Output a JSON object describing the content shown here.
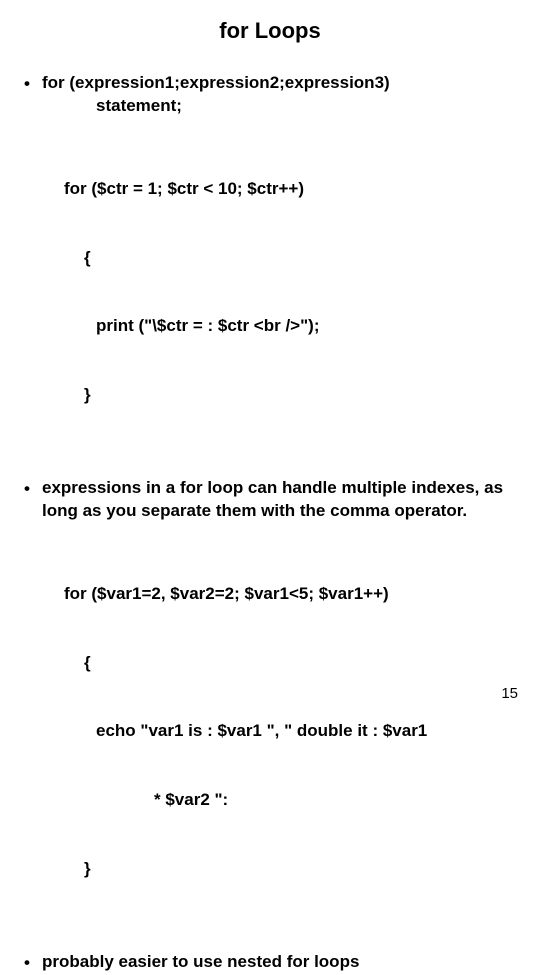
{
  "title": "for Loops",
  "bullets": {
    "b1_line1": "for (expression1;expression2;expression3)",
    "b1_line2": "statement;",
    "b2": "expressions in a for loop can handle multiple indexes, as long as you separate them with the comma operator.",
    "b3": "probably easier to use nested for loops"
  },
  "code1": {
    "l1": "for ($ctr = 1; $ctr < 10; $ctr++)",
    "l2": "{",
    "l3": "print (\"\\$ctr = : $ctr <br />\");",
    "l4": "}"
  },
  "code2": {
    "l1": "for ($var1=2, $var2=2; $var1<5; $var1++)",
    "l2": "{",
    "l3": "echo \"var1 is : $var1 \", \" double it : $var1",
    "l4": "* $var2 \":",
    "l5": "}"
  },
  "page_number": "15"
}
